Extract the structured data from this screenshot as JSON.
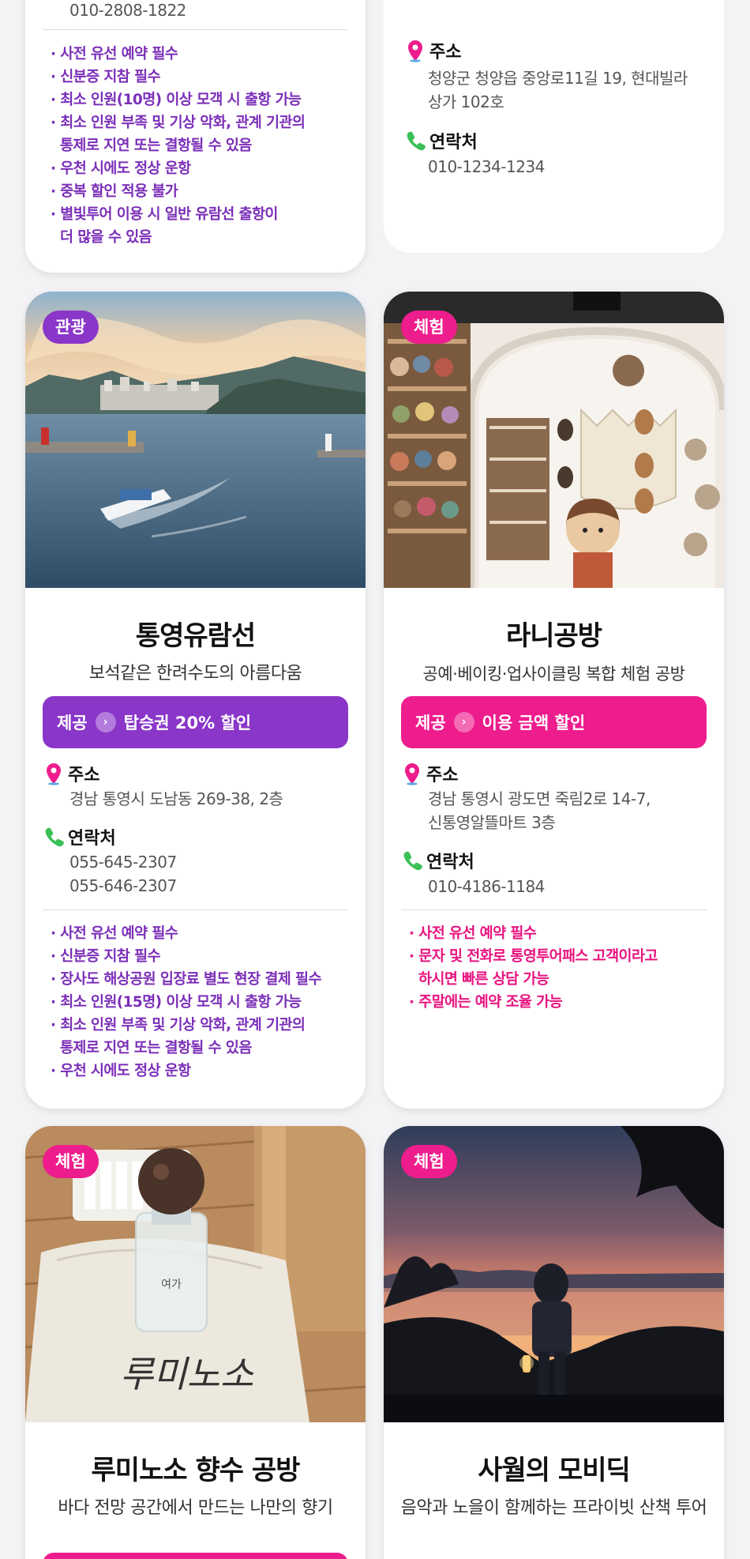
{
  "cards": [
    {
      "phone_tail": "010-2808-1822",
      "notes": [
        "사전 유선 예약 필수",
        "신분증 지참 필수",
        "최소 인원(10명) 이상 모객 시 출항 가능",
        "최소 인원 부족 및 기상 악화, 관계 기관의\n통제로 지연 또는 결항될 수 있음",
        "우천 시에도 정상 운항",
        "중복 할인 적용 불가",
        "별빛투어 이용 시 일반 유람선 출항이\n더 많을 수 있음"
      ]
    },
    {
      "address_label": "주소",
      "address": "청양군 청양읍 중앙로11길 19, 현대빌라\n상가 102호",
      "contact_label": "연락처",
      "phone": "010-1234-1234"
    },
    {
      "badge": "관광",
      "title": "통영유람선",
      "subtitle": "보석같은 한려수도의 아름다움",
      "offer_prefix": "제공",
      "offer": "탑승권 20% 할인",
      "address_label": "주소",
      "address": "경남 통영시 도남동 269-38, 2층",
      "contact_label": "연락처",
      "phone": "055-645-2307\n055-646-2307",
      "notes": [
        "사전 유선 예약 필수",
        "신분증 지참 필수",
        "장사도 해상공원 입장료 별도 현장 결제 필수",
        "최소 인원(15명) 이상 모객 시 출항 가능",
        "최소 인원 부족 및 기상 악화, 관계 기관의\n통제로 지연 또는 결항될 수 있음",
        "우천 시에도 정상 운항"
      ]
    },
    {
      "badge": "체험",
      "title": "라니공방",
      "subtitle": "공예·베이킹·업사이클링 복합 체험 공방",
      "offer_prefix": "제공",
      "offer": "이용 금액 할인",
      "address_label": "주소",
      "address": "경남 통영시 광도면 죽림2로 14-7,\n신통영알뜰마트 3층",
      "contact_label": "연락처",
      "phone": "010-4186-1184",
      "notes": [
        "사전 유선 예약 필수",
        "문자 및 전화로 통영투어패스 고객이라고\n하시면 빠른 상담 가능",
        "주말에는 예약 조율 가능"
      ]
    },
    {
      "badge": "체험",
      "title": "루미노소 향수 공방",
      "subtitle": "바다 전망 공간에서 만드는 나만의 향기",
      "bottle_label": "여가",
      "bag_signature": "루미노소"
    },
    {
      "badge": "체험",
      "title": "사월의 모비딕",
      "subtitle": "음악과 노을이 함께하는\n프라이빗 산책 투어"
    }
  ],
  "colors": {
    "purple": "#8a36c9",
    "pink": "#ee1d8d"
  },
  "icons": {
    "address": "map-pin-icon",
    "contact": "phone-icon",
    "offer": "chevron-right-icon"
  }
}
